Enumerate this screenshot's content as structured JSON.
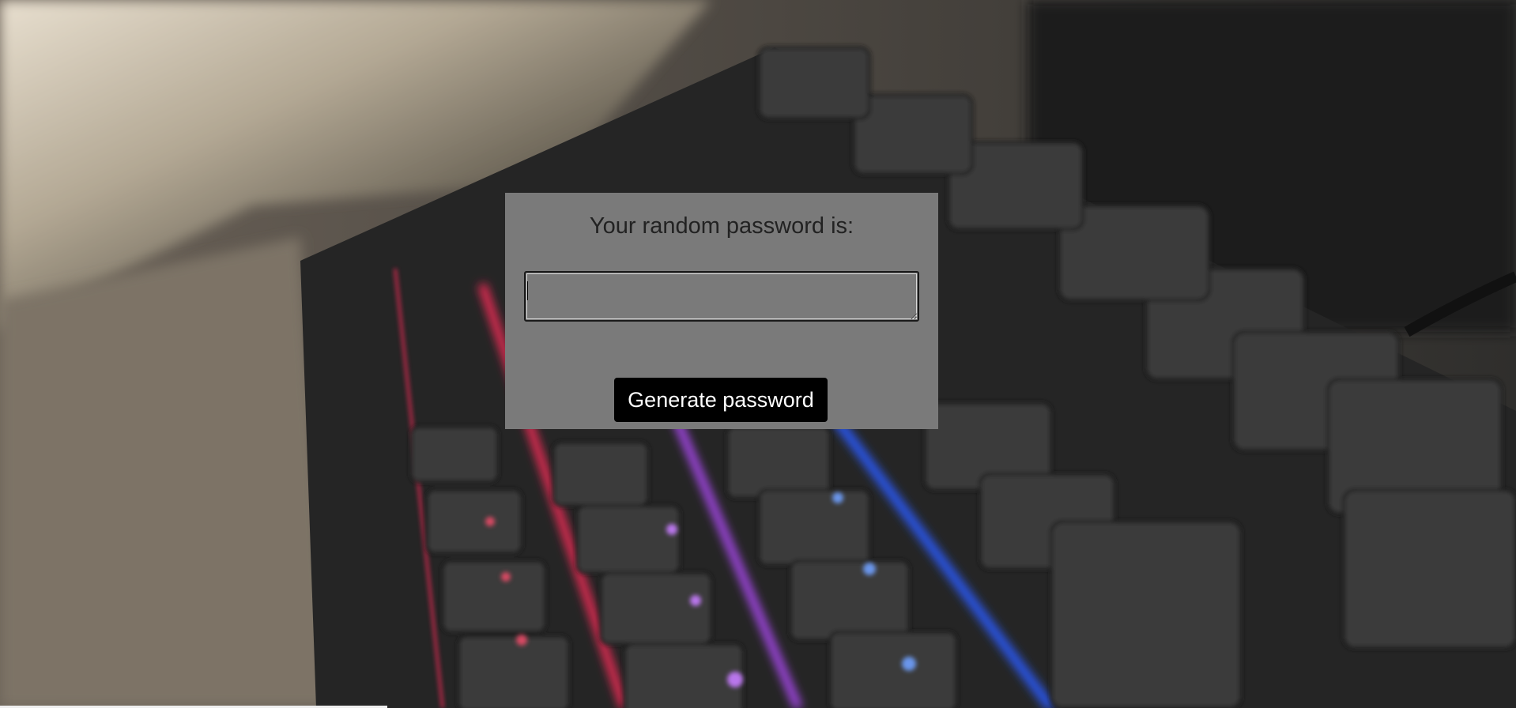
{
  "background": {
    "icon": "keyboard-photo",
    "colors": {
      "base": "#3a3836",
      "light_wall": "#cfc7b8",
      "key": "#2b2b2b",
      "key_top": "#3e3e3e",
      "glow_red": "#ff2a5a",
      "glow_purple": "#b44cff",
      "glow_blue": "#2b5cff"
    }
  },
  "card": {
    "title": "Your random password is:",
    "password_value": "",
    "button_label": "Generate password",
    "colors": {
      "panel": "#7a7a7a",
      "title_text": "#222222",
      "button_bg": "#000000",
      "button_text": "#ffffff"
    }
  }
}
